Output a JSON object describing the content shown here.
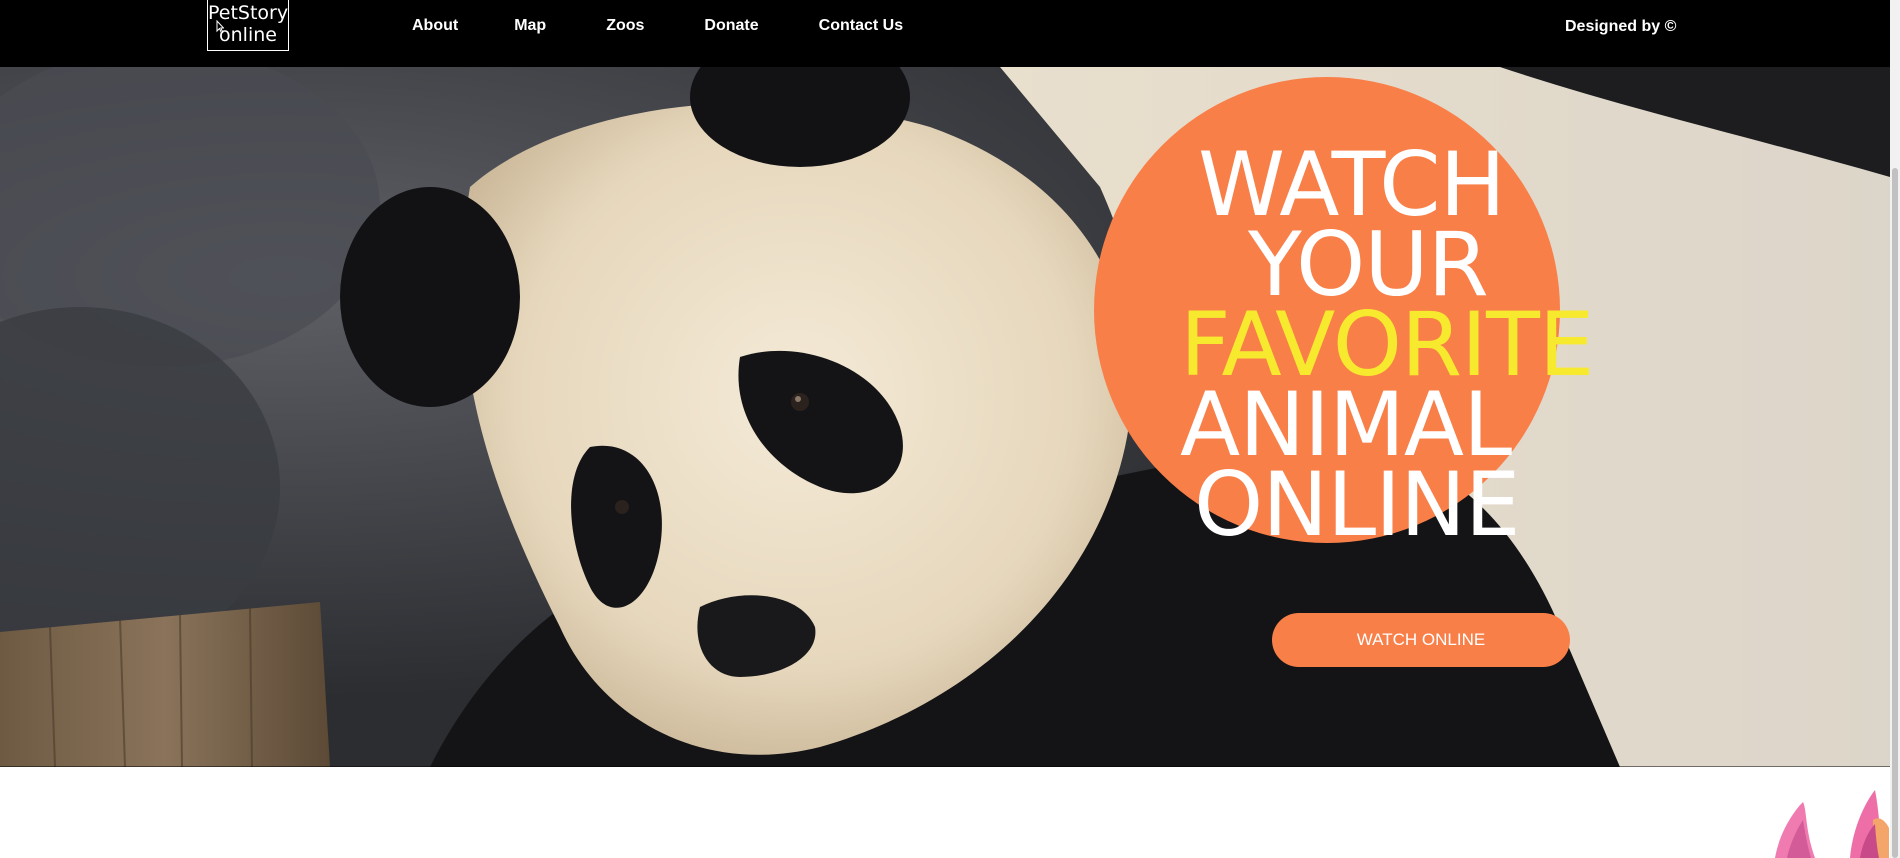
{
  "header": {
    "logo_line1": "PetStory",
    "logo_line2": "online",
    "nav": {
      "about": "About",
      "map": "Map",
      "zoos": "Zoos",
      "donate": "Donate",
      "contact": "Contact Us"
    },
    "designed_by": "Designed by ©"
  },
  "hero": {
    "headline": {
      "line1": "WATCH",
      "line2": "YOUR",
      "line3": "FAVORITE",
      "line4": "ANIMAL",
      "line5": "ONLINE"
    },
    "cta_label": "WATCH ONLINE",
    "image": "giant-panda-photo"
  },
  "colors": {
    "header_bg": "#000000",
    "accent_orange": "#f97f49",
    "highlight_yellow": "#f7ea2e",
    "text_white": "#ffffff"
  }
}
